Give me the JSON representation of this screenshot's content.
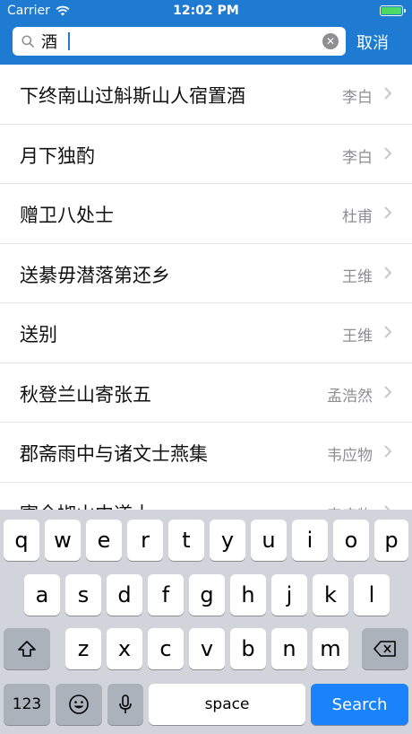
{
  "status_bar": {
    "carrier": "Carrier",
    "time": "12:02 PM",
    "battery_color": "#4cd964"
  },
  "search": {
    "value": "酒",
    "placeholder": "",
    "cancel_label": "取消",
    "icon": "search-icon",
    "clear_icon": "clear-icon"
  },
  "theme": {
    "header_bg": "#1f7bd2",
    "keyboard_bg": "#d1d5db",
    "search_key_bg": "#1a82fb"
  },
  "results": [
    {
      "title": "下终南山过斛斯山人宿置酒",
      "author": "李白"
    },
    {
      "title": "月下独酌",
      "author": "李白"
    },
    {
      "title": "赠卫八处士",
      "author": "杜甫"
    },
    {
      "title": "送綦毋潜落第还乡",
      "author": "王维"
    },
    {
      "title": "送别",
      "author": "王维"
    },
    {
      "title": "秋登兰山寄张五",
      "author": "孟浩然"
    },
    {
      "title": "郡斋雨中与诸文士燕集",
      "author": "韦应物"
    },
    {
      "title": "寄全椒山中道士",
      "author": "韦应物"
    }
  ],
  "keyboard": {
    "row1": [
      "q",
      "w",
      "e",
      "r",
      "t",
      "y",
      "u",
      "i",
      "o",
      "p"
    ],
    "row2": [
      "a",
      "s",
      "d",
      "f",
      "g",
      "h",
      "j",
      "k",
      "l"
    ],
    "row3": [
      "z",
      "x",
      "c",
      "v",
      "b",
      "n",
      "m"
    ],
    "numbers_label": "123",
    "space_label": "space",
    "search_label": "Search",
    "shift_icon": "shift-icon",
    "delete_icon": "delete-icon",
    "emoji_icon": "emoji-icon",
    "mic_icon": "microphone-icon"
  }
}
